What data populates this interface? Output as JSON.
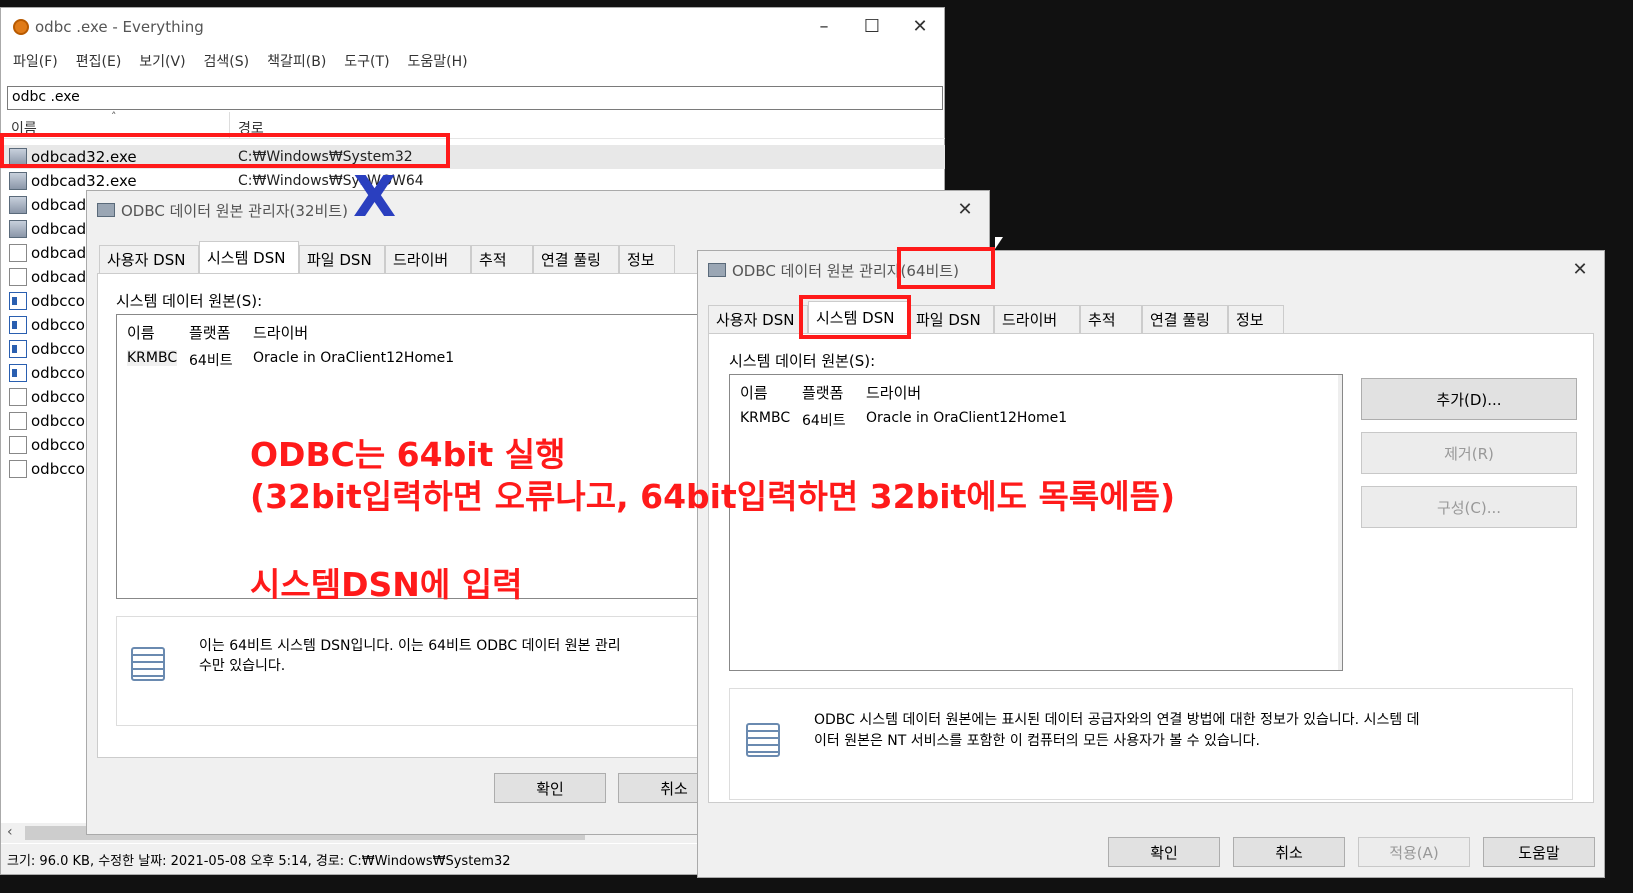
{
  "everything": {
    "title": "odbc .exe - Everything",
    "menu": [
      "파일(F)",
      "편집(E)",
      "보기(V)",
      "검색(S)",
      "책갈피(B)",
      "도구(T)",
      "도움말(H)"
    ],
    "search_value": "odbc .exe",
    "columns": {
      "name": "이름",
      "path": "경로"
    },
    "rows": [
      {
        "name": "odbcad32.exe",
        "path": "C:₩Windows₩System32",
        "icon": "exe-icon"
      },
      {
        "name": "odbcad32.exe",
        "path": "C:₩Windows₩SysWOW64",
        "icon": "exe-icon"
      },
      {
        "name": "odbcad",
        "path": "",
        "icon": "exe-icon"
      },
      {
        "name": "odbcad",
        "path": "",
        "icon": "exe-icon"
      },
      {
        "name": "odbcad",
        "path": "",
        "icon": "document-icon"
      },
      {
        "name": "odbcad",
        "path": "",
        "icon": "document-icon"
      },
      {
        "name": "odbcco",
        "path": "",
        "icon": "control-panel-icon"
      },
      {
        "name": "odbcco",
        "path": "",
        "icon": "control-panel-icon"
      },
      {
        "name": "odbcco",
        "path": "",
        "icon": "control-panel-icon"
      },
      {
        "name": "odbcco",
        "path": "",
        "icon": "control-panel-icon"
      },
      {
        "name": "odbcco",
        "path": "",
        "icon": "document-icon"
      },
      {
        "name": "odbcco",
        "path": "",
        "icon": "document-icon"
      },
      {
        "name": "odbcco",
        "path": "",
        "icon": "document-icon"
      },
      {
        "name": "odbcco",
        "path": "",
        "icon": "document-icon"
      }
    ],
    "status": "크기: 96.0 KB, 수정한 날짜: 2021-05-08 오후 5:14, 경로: C:₩Windows₩System32"
  },
  "dialog32": {
    "title": "ODBC 데이터 원본 관리자(32비트)",
    "tabs": [
      "사용자 DSN",
      "시스템 DSN",
      "파일 DSN",
      "드라이버",
      "추적",
      "연결 풀링",
      "정보"
    ],
    "section_label": "시스템 데이터 원본(S):",
    "list_headers": [
      "이름",
      "플랫폼",
      "드라이버"
    ],
    "list_row": [
      "KRMBC",
      "64비트",
      "Oracle in OraClient12Home1"
    ],
    "info_text_1": "이는 64비트 시스템 DSN입니다. 이는 64비트 ODBC 데이터 원본 관리",
    "info_text_2": "수만 있습니다.",
    "buttons": {
      "ok": "확인",
      "cancel": "취소"
    }
  },
  "dialog64": {
    "title": "ODBC 데이터 원본 관리자(64비트)",
    "tabs": [
      "사용자 DSN",
      "시스템 DSN",
      "파일 DSN",
      "드라이버",
      "추적",
      "연결 풀링",
      "정보"
    ],
    "section_label": "시스템 데이터 원본(S):",
    "list_headers": [
      "이름",
      "플랫폼",
      "드라이버"
    ],
    "list_row": [
      "KRMBC",
      "64비트",
      "Oracle in OraClient12Home1"
    ],
    "side_buttons": {
      "add": "추가(D)...",
      "remove": "제거(R)",
      "configure": "구성(C)..."
    },
    "info_text_1": "ODBC 시스템 데이터 원본에는 표시된 데이터 공급자와의 연결 방법에 대한 정보가 있습니다. 시스템 데",
    "info_text_2": "이터 원본은 NT 서비스를 포함한 이 컴퓨터의 모든 사용자가 볼 수 있습니다.",
    "buttons": {
      "ok": "확인",
      "cancel": "취소",
      "apply": "적용(A)",
      "help": "도움말"
    }
  },
  "annotations": {
    "x_mark": "X",
    "line1": "ODBC는 64bit 실행",
    "line2": "(32bit입력하면 오류나고, 64bit입력하면 32bit에도 목록에뜸)",
    "line3": "시스템DSN에 입력"
  },
  "colors": {
    "annotation_red": "#ff1a1a",
    "annotation_blue": "#2a3fbf",
    "window_bg": "#f0f0f0"
  }
}
